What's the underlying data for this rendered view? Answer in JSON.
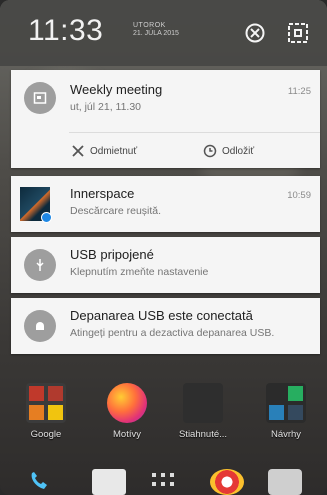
{
  "status": {
    "time": "11:33",
    "day": "UTOROK",
    "date": "21. JÚLA 2015"
  },
  "header_icons": [
    "do-not-disturb-icon",
    "settings-icon"
  ],
  "notifications": [
    {
      "title": "Weekly meeting",
      "subtitle": "ut, júl 21, 11.30",
      "time": "11:25",
      "icon": "calendar-icon",
      "actions": [
        {
          "label": "Odmietnuť",
          "icon": "close-icon"
        },
        {
          "label": "Odložiť",
          "icon": "snooze-clock-icon"
        }
      ]
    },
    {
      "title": "Innerspace",
      "subtitle": "Descărcare reușită.",
      "time": "10:59",
      "icon": "game-thumbnail"
    },
    {
      "title": "USB pripojené",
      "subtitle": "Klepnutím zmeňte nastavenie",
      "icon": "usb-icon"
    },
    {
      "title": "Depanarea USB este conectată",
      "subtitle": "Atingeți pentru a dezactiva depanarea USB.",
      "icon": "android-debug-icon"
    }
  ],
  "home_apps": [
    {
      "label": "Google",
      "icon": "google-folder-icon"
    },
    {
      "label": "Motívy",
      "icon": "themes-icon"
    },
    {
      "label": "Stiahnuté...",
      "icon": "downloads-icon"
    },
    {
      "label": "Návrhy",
      "icon": "suggestions-folder-icon"
    }
  ],
  "colors": {
    "header_bg": "#464644",
    "card_bg": "#f5f5f5",
    "icon_gray": "#9e9e9e",
    "text_primary": "#212121",
    "text_secondary": "#757575"
  }
}
